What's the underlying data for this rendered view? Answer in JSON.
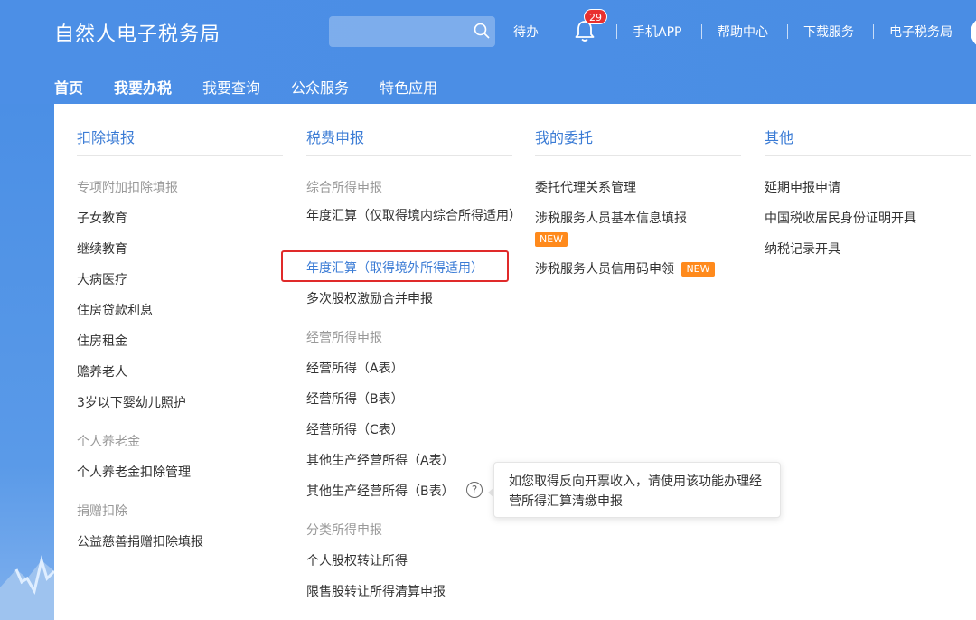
{
  "header": {
    "brand": "自然人电子税务局",
    "search": {
      "placeholder": "",
      "value": ""
    },
    "nav": {
      "todo": "待办",
      "badge": "29",
      "app": "手机APP",
      "help": "帮助中心",
      "download": "下载服务",
      "etax": "电子税务局"
    }
  },
  "main_nav": {
    "tabs": [
      {
        "label": "首页"
      },
      {
        "label": "我要办税"
      },
      {
        "label": "我要查询"
      },
      {
        "label": "公众服务"
      },
      {
        "label": "特色应用"
      }
    ]
  },
  "menu": {
    "deduction": {
      "title": "扣除填报",
      "groups": [
        {
          "label": "专项附加扣除填报",
          "items": [
            "子女教育",
            "继续教育",
            "大病医疗",
            "住房贷款利息",
            "住房租金",
            "赡养老人",
            "3岁以下婴幼儿照护"
          ]
        },
        {
          "label": "个人养老金",
          "items": [
            "个人养老金扣除管理"
          ]
        },
        {
          "label": "捐赠扣除",
          "items": [
            "公益慈善捐赠扣除填报"
          ]
        }
      ]
    },
    "declaration": {
      "title": "税费申报",
      "groups": [
        {
          "label": "综合所得申报",
          "items": [
            "年度汇算（仅取得境内综合所得适用）",
            "年度汇算（取得境外所得适用）",
            "多次股权激励合并申报"
          ]
        },
        {
          "label": "经营所得申报",
          "items": [
            "经营所得（A表）",
            "经营所得（B表）",
            "经营所得（C表）",
            "其他生产经营所得（A表）",
            "其他生产经营所得（B表）"
          ]
        },
        {
          "label": "分类所得申报",
          "items": [
            "个人股权转让所得",
            "限售股转让所得清算申报"
          ]
        }
      ],
      "help_icon": "?",
      "tooltip": "如您取得反向开票收入，请使用该功能办理经营所得汇算清缴申报"
    },
    "delegation": {
      "title": "我的委托",
      "items": [
        "委托代理关系管理",
        "涉税服务人员基本信息填报",
        "涉税服务人员信用码申领"
      ],
      "new_tag": "NEW"
    },
    "other": {
      "title": "其他",
      "items": [
        "延期申报申请",
        "中国税收居民身份证明开具",
        "纳税记录开具"
      ]
    }
  },
  "colors": {
    "header_blue": "#4a8de4",
    "link_blue": "#3a7bd5",
    "highlight_red": "#e02a2a",
    "new_orange": "#ff8a1c",
    "badge_red": "#e9302f"
  }
}
